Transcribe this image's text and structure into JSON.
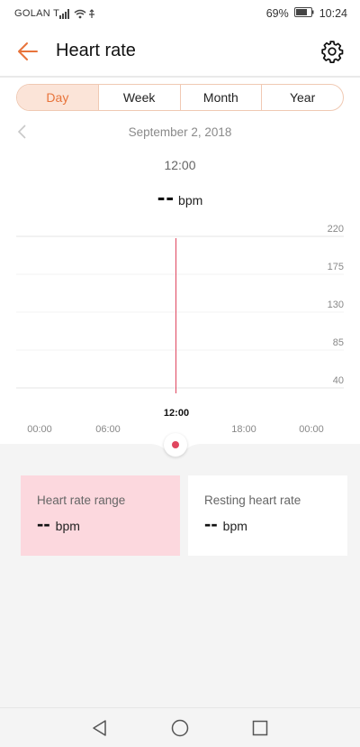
{
  "status_bar": {
    "carrier": "GOLAN T",
    "battery_percent": "69%",
    "time": "10:24"
  },
  "header": {
    "title": "Heart rate",
    "back_icon": "arrow-left-icon",
    "settings_icon": "gear-icon"
  },
  "tabs": [
    {
      "label": "Day",
      "selected": true
    },
    {
      "label": "Week",
      "selected": false
    },
    {
      "label": "Month",
      "selected": false
    },
    {
      "label": "Year",
      "selected": false
    }
  ],
  "date": "September 2, 2018",
  "selected_time": "12:00",
  "current_value": "--",
  "unit": "bpm",
  "chart": {
    "y_ticks": [
      "220",
      "175",
      "130",
      "85",
      "40"
    ],
    "x_ticks": [
      "00:00",
      "06:00",
      "12:00",
      "18:00",
      "00:00"
    ],
    "selected_tick": "12:00"
  },
  "cards": [
    {
      "label": "Heart rate range",
      "value": "--",
      "unit": "bpm"
    },
    {
      "label": "Resting heart rate",
      "value": "--",
      "unit": "bpm"
    }
  ],
  "colors": {
    "accent": "#e8743b",
    "marker": "#e0465f",
    "range_card": "#fcd8de"
  }
}
